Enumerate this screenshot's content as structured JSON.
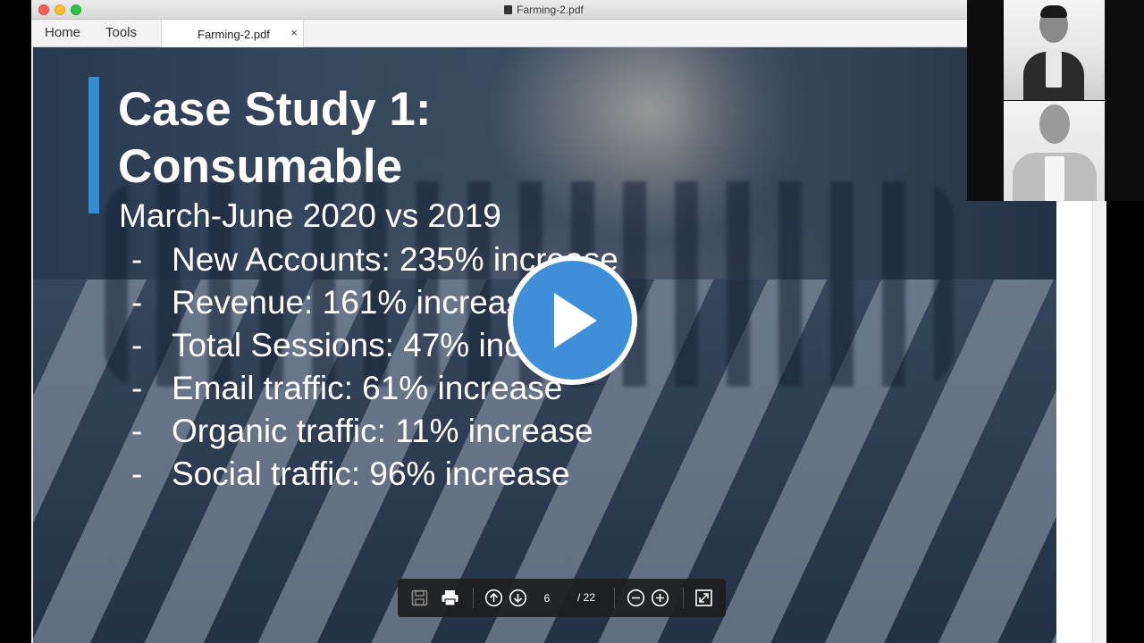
{
  "window": {
    "title": "Farming-2.pdf"
  },
  "tabs": {
    "home": "Home",
    "tools": "Tools",
    "document": "Farming-2.pdf",
    "close_glyph": "×"
  },
  "slide": {
    "title": "Case Study 1:\nConsumable",
    "subtitle": "March-June 2020 vs 2019",
    "bullet_marker": "-",
    "bullets": [
      "New Accounts: 235% increase",
      "Revenue: 161% increase",
      "Total Sessions: 47% increase",
      "Email traffic: 61% increase",
      "Organic traffic: 11% increase",
      "Social traffic: 96% increase"
    ],
    "accent_color": "#2f8fd5"
  },
  "player": {
    "play_icon": "play-icon",
    "color": "#3f8fd8"
  },
  "toolbar": {
    "icons": [
      "save-icon",
      "print-icon",
      "page-up-icon",
      "page-down-icon",
      "zoom-out-icon",
      "zoom-in-icon",
      "fit-page-icon"
    ],
    "current_page": "6",
    "total_pages": "/ 22"
  },
  "participants": {
    "count_visible": 2
  }
}
